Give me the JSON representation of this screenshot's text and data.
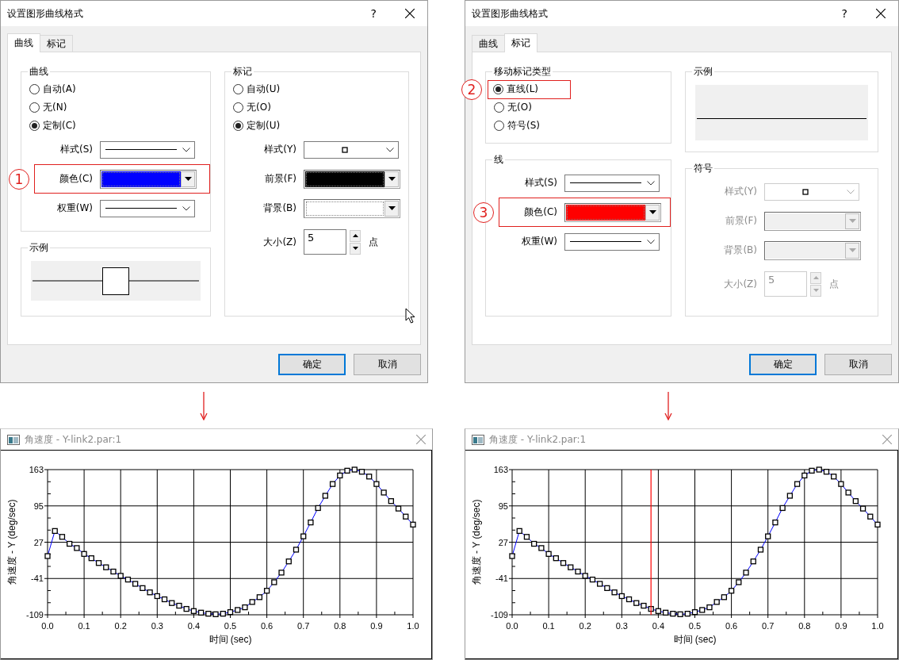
{
  "dialogs": [
    {
      "title": "设置图形曲线格式",
      "help": "?",
      "pointer_visible": true,
      "tabs": [
        {
          "label": "曲线",
          "selected": true
        },
        {
          "label": "标记",
          "selected": false
        }
      ],
      "columns": [
        {
          "groups": [
            {
              "title": "曲线",
              "disabled": false,
              "rows": [
                {
                  "kind": "radio",
                  "label": "自动(A)",
                  "selected": false
                },
                {
                  "kind": "radio",
                  "label": "无(N)",
                  "selected": false
                },
                {
                  "kind": "radio",
                  "label": "定制(C)",
                  "selected": true
                },
                {
                  "kind": "line-combo",
                  "label": "样式(S)"
                },
                {
                  "kind": "color",
                  "label": "颜色(C)",
                  "color": "#0000ff",
                  "callout": "1"
                },
                {
                  "kind": "line-combo",
                  "label": "权重(W)"
                }
              ]
            },
            {
              "title": "示例",
              "disabled": false,
              "rows": [
                {
                  "kind": "line-marker-preview"
                }
              ]
            }
          ]
        },
        {
          "groups": [
            {
              "title": "标记",
              "disabled": false,
              "rows": [
                {
                  "kind": "radio",
                  "label": "自动(U)",
                  "selected": false
                },
                {
                  "kind": "radio",
                  "label": "无(O)",
                  "selected": false
                },
                {
                  "kind": "radio",
                  "label": "定制(U)",
                  "selected": true
                },
                {
                  "kind": "marker-combo",
                  "label": "样式(Y)"
                },
                {
                  "kind": "color",
                  "label": "前景(F)",
                  "color": "#000000"
                },
                {
                  "kind": "color",
                  "label": "背景(B)",
                  "color": "#ffffff"
                },
                {
                  "kind": "spin",
                  "label": "大小(Z)",
                  "value": "5",
                  "unit": "点"
                }
              ]
            }
          ]
        }
      ],
      "buttons": [
        {
          "label": "确定",
          "default": true
        },
        {
          "label": "取消",
          "default": false
        }
      ]
    },
    {
      "title": "设置图形曲线格式",
      "help": "?",
      "tabs": [
        {
          "label": "曲线",
          "selected": false
        },
        {
          "label": "标记",
          "selected": true
        }
      ],
      "columns": [
        {
          "groups": [
            {
              "title": "移动标记类型",
              "disabled": false,
              "rows": [
                {
                  "kind": "radio",
                  "label": "直线(L)",
                  "selected": true,
                  "callout": "2"
                },
                {
                  "kind": "radio",
                  "label": "无(O)",
                  "selected": false
                },
                {
                  "kind": "radio",
                  "label": "符号(S)",
                  "selected": false
                }
              ]
            },
            {
              "title": "线",
              "disabled": false,
              "rows": [
                {
                  "kind": "line-combo",
                  "label": "样式(S)"
                },
                {
                  "kind": "color",
                  "label": "颜色(C)",
                  "color": "#ff0000",
                  "callout": "3"
                },
                {
                  "kind": "line-combo",
                  "label": "权重(W)"
                }
              ]
            }
          ]
        },
        {
          "groups": [
            {
              "title": "示例",
              "disabled": false,
              "rows": [
                {
                  "kind": "line-preview"
                }
              ]
            },
            {
              "title": "符号",
              "disabled": true,
              "rows": [
                {
                  "kind": "marker-combo",
                  "label": "样式(Y)"
                },
                {
                  "kind": "color",
                  "label": "前景(F)"
                },
                {
                  "kind": "color",
                  "label": "背景(B)"
                },
                {
                  "kind": "spin",
                  "label": "大小(Z)",
                  "value": "5",
                  "unit": "点"
                }
              ]
            }
          ]
        }
      ],
      "buttons": [
        {
          "label": "确定",
          "default": true
        },
        {
          "label": "取消",
          "default": false
        }
      ]
    }
  ],
  "charts": [
    {
      "title": "角速度 - Y-link2.par:1",
      "chart_data": {
        "type": "line",
        "xlabel": "时间 (sec)",
        "ylabel": "角速度 - Y (deg/sec)",
        "x": [
          0,
          0.02,
          0.04,
          0.06,
          0.08,
          0.1,
          0.12,
          0.14,
          0.16,
          0.18,
          0.2,
          0.22,
          0.24,
          0.26,
          0.28,
          0.3,
          0.32,
          0.34,
          0.36,
          0.38,
          0.4,
          0.42,
          0.44,
          0.46,
          0.48,
          0.5,
          0.52,
          0.54,
          0.56,
          0.58,
          0.6,
          0.62,
          0.64,
          0.66,
          0.68,
          0.7,
          0.72,
          0.74,
          0.76,
          0.78,
          0.8,
          0.82,
          0.84,
          0.86,
          0.88,
          0.9,
          0.92,
          0.94,
          0.96,
          0.98,
          1
        ],
        "series": [
          {
            "color": "#0000ff",
            "marker": "square",
            "values": [
              1,
              48,
              37,
              24,
              16,
              5,
              -3,
              -12,
              -20,
              -28,
              -36,
              -43,
              -51,
              -59,
              -67,
              -74,
              -80,
              -87,
              -92,
              -98,
              -102,
              -105,
              -107,
              -108,
              -107,
              -104,
              -100,
              -95,
              -85,
              -76,
              -64,
              -48,
              -30,
              -9,
              13,
              38,
              64,
              91,
              114,
              136,
              152,
              161,
              163,
              159,
              150,
              136,
              120,
              104,
              90,
              75,
              60
            ]
          }
        ],
        "xlim": [
          0,
          1
        ],
        "ylim": [
          -109,
          163
        ],
        "grid": true,
        "xticks": [
          {
            "value": 0,
            "label": "0.0"
          },
          {
            "value": 0.1,
            "label": "0.1"
          },
          {
            "value": 0.2,
            "label": "0.2"
          },
          {
            "value": 0.3,
            "label": "0.3"
          },
          {
            "value": 0.4,
            "label": "0.4"
          },
          {
            "value": 0.5,
            "label": "0.5"
          },
          {
            "value": 0.6,
            "label": "0.6"
          },
          {
            "value": 0.7,
            "label": "0.7"
          },
          {
            "value": 0.8,
            "label": "0.8"
          },
          {
            "value": 0.9,
            "label": "0.9"
          },
          {
            "value": 1,
            "label": "1.0"
          }
        ],
        "yticks": [
          163,
          95,
          27,
          -41,
          -109
        ]
      }
    },
    {
      "title": "角速度 - Y-link2.par:1",
      "chart_data": {
        "type": "line",
        "xlabel": "时间 (sec)",
        "ylabel": "角速度 - Y (deg/sec)",
        "x": [
          0,
          0.02,
          0.04,
          0.06,
          0.08,
          0.1,
          0.12,
          0.14,
          0.16,
          0.18,
          0.2,
          0.22,
          0.24,
          0.26,
          0.28,
          0.3,
          0.32,
          0.34,
          0.36,
          0.38,
          0.4,
          0.42,
          0.44,
          0.46,
          0.48,
          0.5,
          0.52,
          0.54,
          0.56,
          0.58,
          0.6,
          0.62,
          0.64,
          0.66,
          0.68,
          0.7,
          0.72,
          0.74,
          0.76,
          0.78,
          0.8,
          0.82,
          0.84,
          0.86,
          0.88,
          0.9,
          0.92,
          0.94,
          0.96,
          0.98,
          1
        ],
        "series": [
          {
            "color": "#0000ff",
            "marker": "square",
            "values": [
              1,
              48,
              37,
              24,
              16,
              5,
              -3,
              -12,
              -20,
              -28,
              -36,
              -43,
              -51,
              -59,
              -67,
              -74,
              -80,
              -87,
              -92,
              -98,
              -102,
              -105,
              -107,
              -108,
              -107,
              -104,
              -100,
              -95,
              -85,
              -76,
              -64,
              -48,
              -30,
              -9,
              13,
              38,
              64,
              91,
              114,
              136,
              152,
              161,
              163,
              159,
              150,
              136,
              120,
              104,
              90,
              75,
              60
            ]
          }
        ],
        "xlim": [
          0,
          1
        ],
        "ylim": [
          -109,
          163
        ],
        "grid": true,
        "xticks": [
          {
            "value": 0,
            "label": "0.0"
          },
          {
            "value": 0.1,
            "label": "0.1"
          },
          {
            "value": 0.2,
            "label": "0.2"
          },
          {
            "value": 0.3,
            "label": "0.3"
          },
          {
            "value": 0.4,
            "label": "0.4"
          },
          {
            "value": 0.5,
            "label": "0.5"
          },
          {
            "value": 0.6,
            "label": "0.6"
          },
          {
            "value": 0.7,
            "label": "0.7"
          },
          {
            "value": 0.8,
            "label": "0.8"
          },
          {
            "value": 0.9,
            "label": "0.9"
          },
          {
            "value": 1,
            "label": "1.0"
          }
        ],
        "yticks": [
          163,
          95,
          27,
          -41,
          -109
        ],
        "ref_lines": [
          {
            "axis": "x",
            "value": 0.38,
            "color": "#ff0000"
          }
        ]
      }
    }
  ]
}
